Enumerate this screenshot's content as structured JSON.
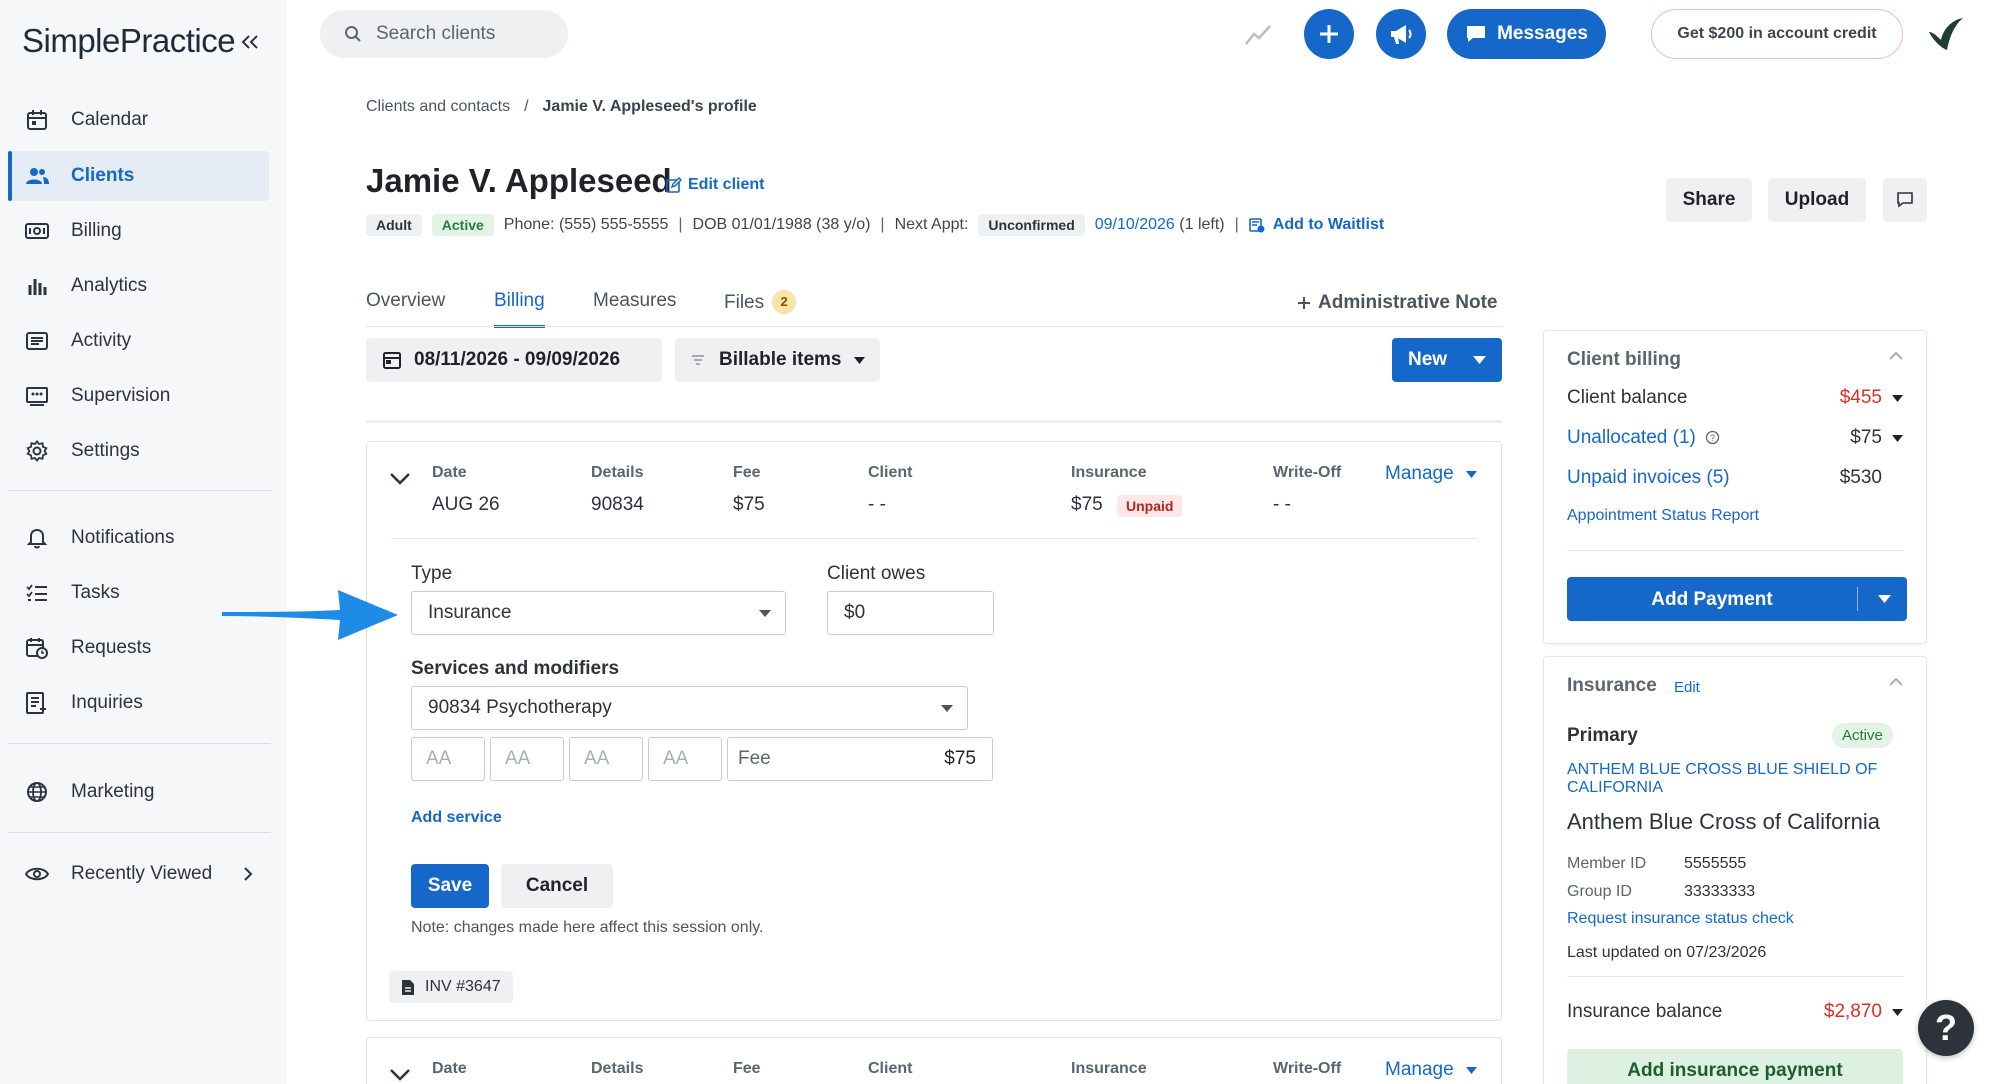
{
  "app": {
    "logo_prefix": "Simple",
    "logo_suffix": "Practice",
    "brand_color": "#1568c9"
  },
  "sidebar": {
    "items": [
      {
        "label": "Calendar",
        "icon": "calendar-icon"
      },
      {
        "label": "Clients",
        "icon": "clients-icon",
        "active": true
      },
      {
        "label": "Billing",
        "icon": "billing-icon"
      },
      {
        "label": "Analytics",
        "icon": "analytics-icon"
      },
      {
        "label": "Activity",
        "icon": "activity-icon"
      },
      {
        "label": "Supervision",
        "icon": "supervision-icon"
      },
      {
        "label": "Settings",
        "icon": "gear-icon"
      },
      {
        "label": "Notifications",
        "icon": "bell-icon"
      },
      {
        "label": "Tasks",
        "icon": "tasks-icon"
      },
      {
        "label": "Requests",
        "icon": "requests-icon"
      },
      {
        "label": "Inquiries",
        "icon": "inquiries-icon"
      },
      {
        "label": "Marketing",
        "icon": "globe-icon"
      },
      {
        "label": "Recently Viewed",
        "icon": "eye-icon"
      }
    ]
  },
  "topbar": {
    "search_placeholder": "Search clients",
    "messages_label": "Messages",
    "credit_label": "Get $200 in account credit"
  },
  "breadcrumb": {
    "parent": "Clients and contacts",
    "separator": "/",
    "current": "Jamie V. Appleseed's profile"
  },
  "client": {
    "name": "Jamie V. Appleseed",
    "edit_label": "Edit client",
    "badge_adult": "Adult",
    "badge_status": "Active",
    "phone": "Phone: (555) 555-5555",
    "dob": "DOB 01/01/1988 (38 y/o)",
    "next_appt_label": "Next Appt:",
    "next_appt_status": "Unconfirmed",
    "next_appt_date": "09/10/2026",
    "next_appt_left": "(1 left)",
    "waitlist_label": "Add to Waitlist",
    "pipe": "|"
  },
  "actions": {
    "share": "Share",
    "upload": "Upload"
  },
  "tabs": {
    "overview": "Overview",
    "billing": "Billing",
    "measures": "Measures",
    "files": "Files",
    "files_count": "2",
    "admin_note": "Administrative Note"
  },
  "filters": {
    "date_range": "08/11/2026 - 09/09/2026",
    "billable": "Billable items",
    "new_label": "New"
  },
  "billing_row": {
    "headers": {
      "date": "Date",
      "details": "Details",
      "fee": "Fee",
      "client": "Client",
      "insurance": "Insurance",
      "writeoff": "Write-Off"
    },
    "date": "AUG 26",
    "details": "90834",
    "fee": "$75",
    "client": "- -",
    "insurance": "$75",
    "insurance_status": "Unpaid",
    "writeoff": "- -",
    "manage_label": "Manage"
  },
  "edit_form": {
    "type_label": "Type",
    "type_value": "Insurance",
    "client_owes_label": "Client owes",
    "client_owes_value": "$0",
    "services_label": "Services and modifiers",
    "service_value": "90834 Psychotherapy",
    "modifier_placeholders": [
      "AA",
      "AA",
      "AA",
      "AA"
    ],
    "fee_placeholder": "Fee",
    "fee_value": "$75",
    "add_service": "Add service",
    "save": "Save",
    "cancel": "Cancel",
    "note": "Note: changes made here affect this session only.",
    "invoice": "INV #3647"
  },
  "client_billing": {
    "title": "Client billing",
    "balance_label": "Client balance",
    "balance_value": "$455",
    "unallocated_label": "Unallocated (1)",
    "unallocated_value": "$75",
    "unpaid_invoices_label": "Unpaid invoices (5)",
    "unpaid_invoices_value": "$530",
    "report_link": "Appointment Status Report",
    "add_payment": "Add Payment"
  },
  "insurance": {
    "title": "Insurance",
    "edit": "Edit",
    "primary_label": "Primary",
    "status": "Active",
    "payer_line1": "ANTHEM BLUE CROSS BLUE SHIELD OF",
    "payer_line2": "CALIFORNIA",
    "plan_name": "Anthem Blue Cross of California",
    "member_id_label": "Member ID",
    "member_id": "5555555",
    "group_id_label": "Group ID",
    "group_id": "33333333",
    "status_check": "Request insurance status check",
    "last_updated": "Last updated on 07/23/2026",
    "balance_label": "Insurance balance",
    "balance_value": "$2,870",
    "add_payment": "Add insurance payment"
  },
  "help_label": "?"
}
